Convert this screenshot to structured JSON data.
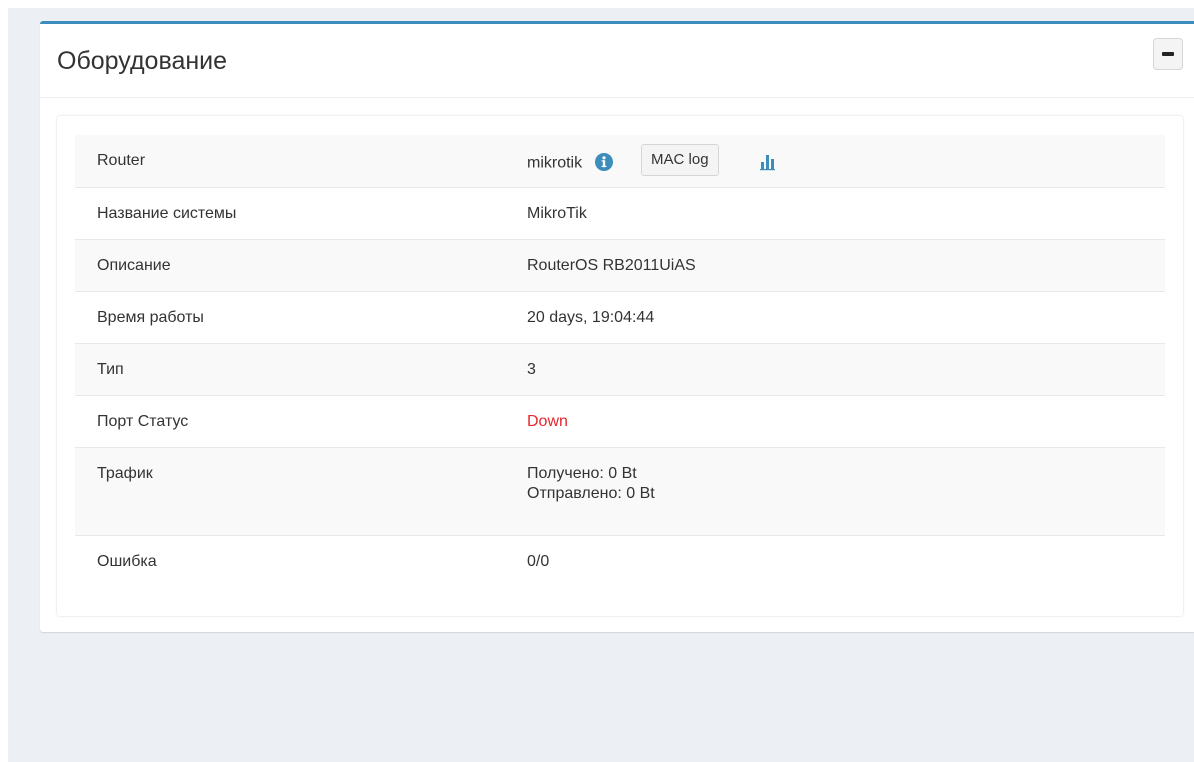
{
  "panel": {
    "title": "Оборудование",
    "collapse_icon": "minus-icon"
  },
  "rows": {
    "router": {
      "label": "Router",
      "value": "mikrotik",
      "info_icon": "info-circle-icon",
      "mac_log_label": "MAC log",
      "chart_icon": "bar-chart-icon"
    },
    "system_name": {
      "label": "Название системы",
      "value": "MikroTik"
    },
    "description": {
      "label": "Описание",
      "value": "RouterOS RB2011UiAS"
    },
    "uptime": {
      "label": "Время работы",
      "value": "20 days, 19:04:44"
    },
    "type": {
      "label": "Тип",
      "value": "3"
    },
    "port_status": {
      "label": "Порт Статус",
      "value": "Down"
    },
    "traffic": {
      "label": "Трафик",
      "received": "Получено: 0 Bt",
      "sent": "Отправлено: 0 Bt"
    },
    "error": {
      "label": "Ошибка",
      "value": "0/0"
    }
  },
  "colors": {
    "accent": "#3c8dbc",
    "status_down": "#e8262f",
    "icon_blue": "#3c8dbc"
  }
}
